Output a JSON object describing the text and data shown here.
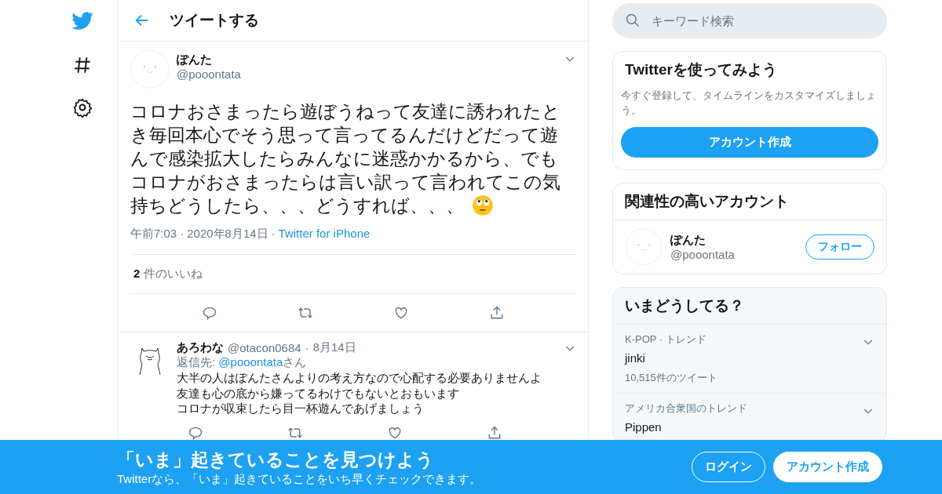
{
  "header": {
    "title": "ツイートする"
  },
  "tweet": {
    "name": "ぽんた",
    "handle": "@pooontata",
    "text_lines": [
      "コロナおさまったら遊ぼうねって友達に誘われたと",
      "き毎回本心でそう思って言ってるんだけどだって遊",
      "んで感染拡大したらみんなに迷惑かかるから、でも",
      "コロナがおさまったらは言い訳って言われてこの気",
      "持ちどうしたら、、、どうすれば、、、"
    ],
    "time": "午前7:03",
    "separator": "·",
    "date": "2020年8月14日",
    "separator_2": "·",
    "source": "Twitter for iPhone",
    "likes_count": "2",
    "likes_label": "件のいいね"
  },
  "reply": {
    "name": "あろわな",
    "handle": "@otacon0684",
    "separator": "·",
    "date": "8月14日",
    "reply_prefix": "返信先: ",
    "reply_to": "@pooontata",
    "reply_suffix": "さん",
    "lines": [
      "大半の人はぽんたさんよりの考え方なので心配する必要ありませんよ",
      "友達も心の底から嫌ってるわけでもないとおもいます",
      "コロナが収束したら目一杯遊んであげましょう"
    ]
  },
  "search": {
    "placeholder": "キーワード検索"
  },
  "signup_card": {
    "title": "Twitterを使ってみよう",
    "text": "今すぐ登録して、タイムラインをカスタマイズしましょう。",
    "button": "アカウント作成"
  },
  "related": {
    "title": "関連性の高いアカウント",
    "accounts": [
      {
        "name": "ぽんた",
        "handle": "@pooontata",
        "button": "フォロー"
      }
    ]
  },
  "trends": {
    "title": "いまどうしてる？",
    "items": [
      {
        "context": "K-POP · トレンド",
        "name": "jinki",
        "count": "10,515件のツイート"
      },
      {
        "context": "アメリカ合衆国のトレンド",
        "name": "Pippen"
      }
    ]
  },
  "banner": {
    "title": "「いま」起きていることを見つけよう",
    "subtitle": "Twitterなら、「いま」起きていることをいち早くチェックできます。",
    "buttons": [
      {
        "label": "ログイン",
        "kind": "outline"
      },
      {
        "label": "アカウント作成",
        "kind": "filled"
      }
    ]
  }
}
